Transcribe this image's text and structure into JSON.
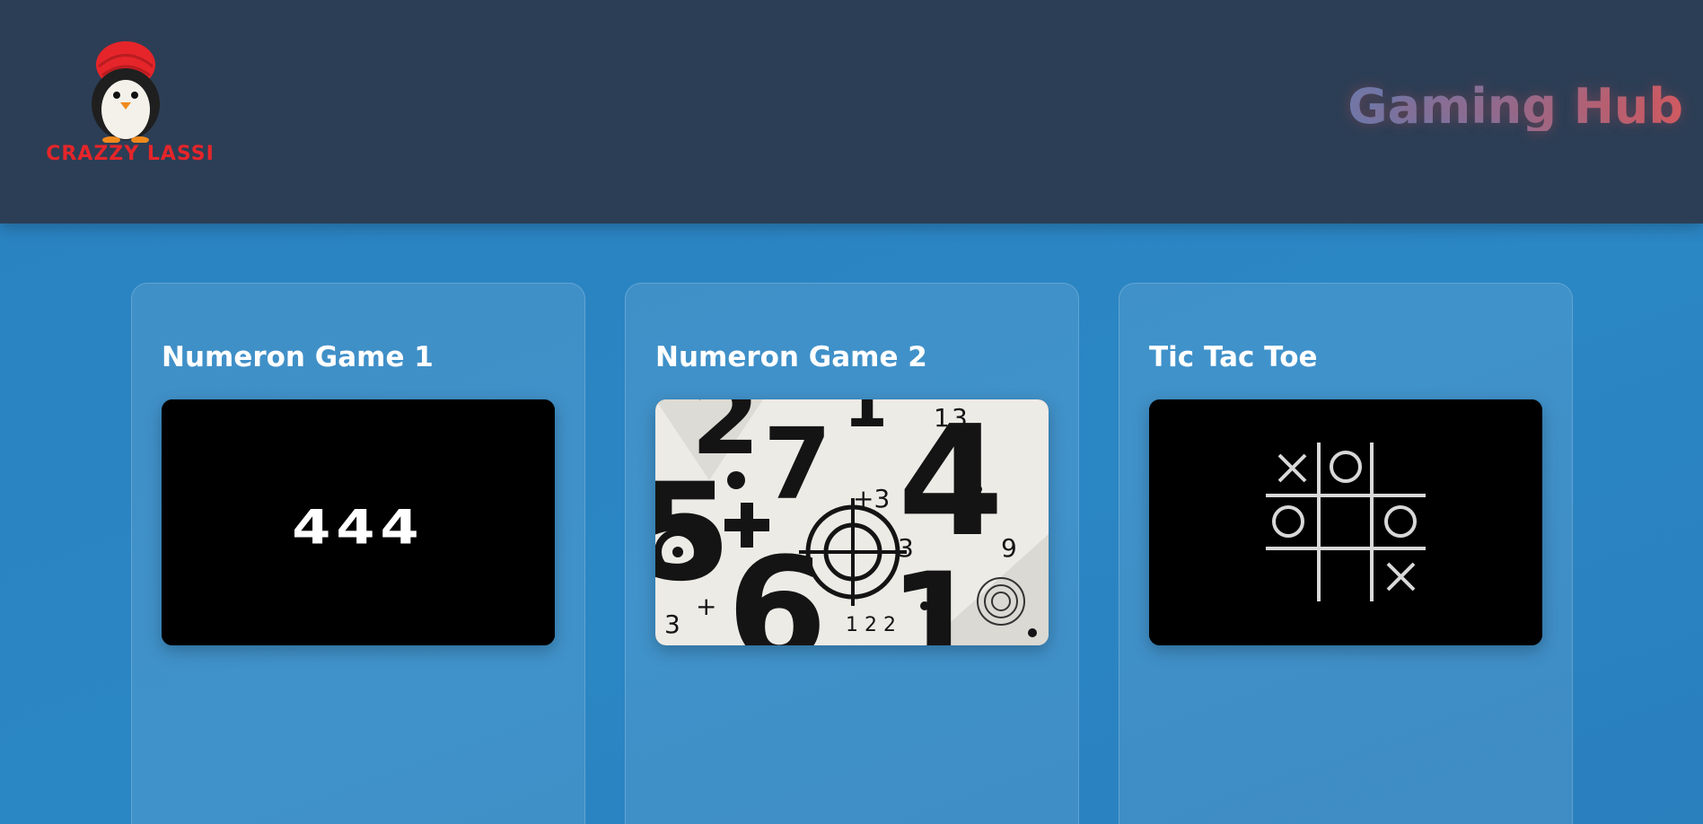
{
  "header": {
    "logo_text": "CRAZZY LASSI",
    "title": "Gaming Hub"
  },
  "games": [
    {
      "title": "Numeron Game 1",
      "thumbnail_text": "444"
    },
    {
      "title": "Numeron Game 2",
      "thumbnail_text": ""
    },
    {
      "title": "Tic Tac Toe",
      "thumbnail_text": ""
    }
  ],
  "colors": {
    "header_bg": "#2c3e55",
    "page_bg": "#2a82c0",
    "logo_red": "#e5252a",
    "title_gradient_start": "#5c80b8",
    "title_gradient_end": "#d05c62"
  },
  "icons": {
    "logo": "penguin-turban-logo",
    "game1": "number-444-thumbnail",
    "game2": "numbers-target-thumbnail",
    "game3": "tic-tac-toe-board-thumbnail"
  }
}
